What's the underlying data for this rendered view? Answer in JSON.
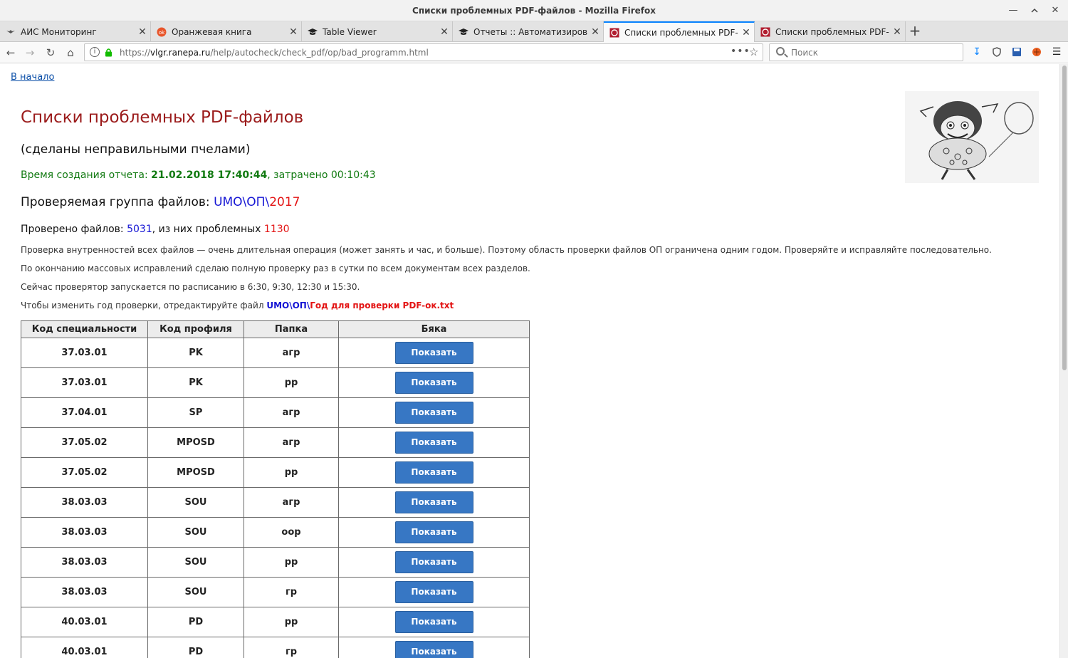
{
  "window": {
    "title": "Списки проблемных PDF-файлов - Mozilla Firefox"
  },
  "tabs": [
    {
      "label": "АИС Мониторинг",
      "icon": "bird-icon",
      "active": false
    },
    {
      "label": "Оранжевая книга",
      "icon": "orange-book-icon",
      "active": false
    },
    {
      "label": "Table Viewer",
      "icon": "graduation-cap-icon",
      "active": false
    },
    {
      "label": "Отчеты :: Автоматизирова",
      "icon": "graduation-cap-icon",
      "active": false
    },
    {
      "label": "Списки проблемных PDF-ф",
      "icon": "ranepa-icon",
      "active": true
    },
    {
      "label": "Списки проблемных PDF-ф",
      "icon": "ranepa-icon",
      "active": false
    }
  ],
  "navbar": {
    "url_prefix": "https://",
    "url_host": "vlgr.ranepa.ru",
    "url_path": "/help/autocheck/check_pdf/op/bad_programm.html",
    "search_placeholder": "Поиск"
  },
  "page": {
    "home_link": "В начало",
    "title": "Списки проблемных PDF-файлов",
    "subtitle": "(сделаны неправильными пчелами)",
    "time_prefix": "Время создания отчета: ",
    "time_value": "21.02.2018 17:40:44",
    "time_suffix": ", затрачено 00:10:43",
    "group_prefix": "Проверяемая группа файлов: ",
    "group_path": "UMO\\ОП\\",
    "group_year": "2017",
    "checked_prefix": "Проверено файлов: ",
    "checked_count": "5031",
    "checked_middle": ", из них проблемных ",
    "problem_count": "1130",
    "note1": "Проверка внутренностей всех файлов — очень длительная операция (может занять и час, и больше). Поэтому область проверки файлов ОП ограничена одним годом. Проверяйте и исправляйте последовательно.",
    "note2": "По окончанию массовых исправлений сделаю полную проверку раз в сутки по всем документам всех разделов.",
    "note3": "Сейчас проверятор запускается по расписанию в 6:30, 9:30, 12:30 и 15:30.",
    "note4_prefix": "Чтобы изменить год проверки, отредактируйте файл ",
    "note4_path": "UMO\\ОП\\",
    "note4_file": "Год для проверки PDF-ок.txt"
  },
  "table": {
    "headers": [
      "Код специальности",
      "Код профиля",
      "Папка",
      "Бяка"
    ],
    "button_label": "Показать",
    "rows": [
      {
        "code": "37.03.01",
        "profile": "PK",
        "folder": "агр"
      },
      {
        "code": "37.03.01",
        "profile": "PK",
        "folder": "рр"
      },
      {
        "code": "37.04.01",
        "profile": "SP",
        "folder": "агр"
      },
      {
        "code": "37.05.02",
        "profile": "MPOSD",
        "folder": "агр"
      },
      {
        "code": "37.05.02",
        "profile": "MPOSD",
        "folder": "рр"
      },
      {
        "code": "38.03.03",
        "profile": "SOU",
        "folder": "агр"
      },
      {
        "code": "38.03.03",
        "profile": "SOU",
        "folder": "оор"
      },
      {
        "code": "38.03.03",
        "profile": "SOU",
        "folder": "рр"
      },
      {
        "code": "38.03.03",
        "profile": "SOU",
        "folder": "гр"
      },
      {
        "code": "40.03.01",
        "profile": "PD",
        "folder": "рр"
      },
      {
        "code": "40.03.01",
        "profile": "PD",
        "folder": "гр"
      }
    ]
  },
  "colors": {
    "title": "#9b1b1b",
    "time": "#117a11",
    "blue_value": "#1515d4",
    "red_value": "#e31414",
    "button": "#3777c4",
    "active_tab_accent": "#0a84ff"
  }
}
